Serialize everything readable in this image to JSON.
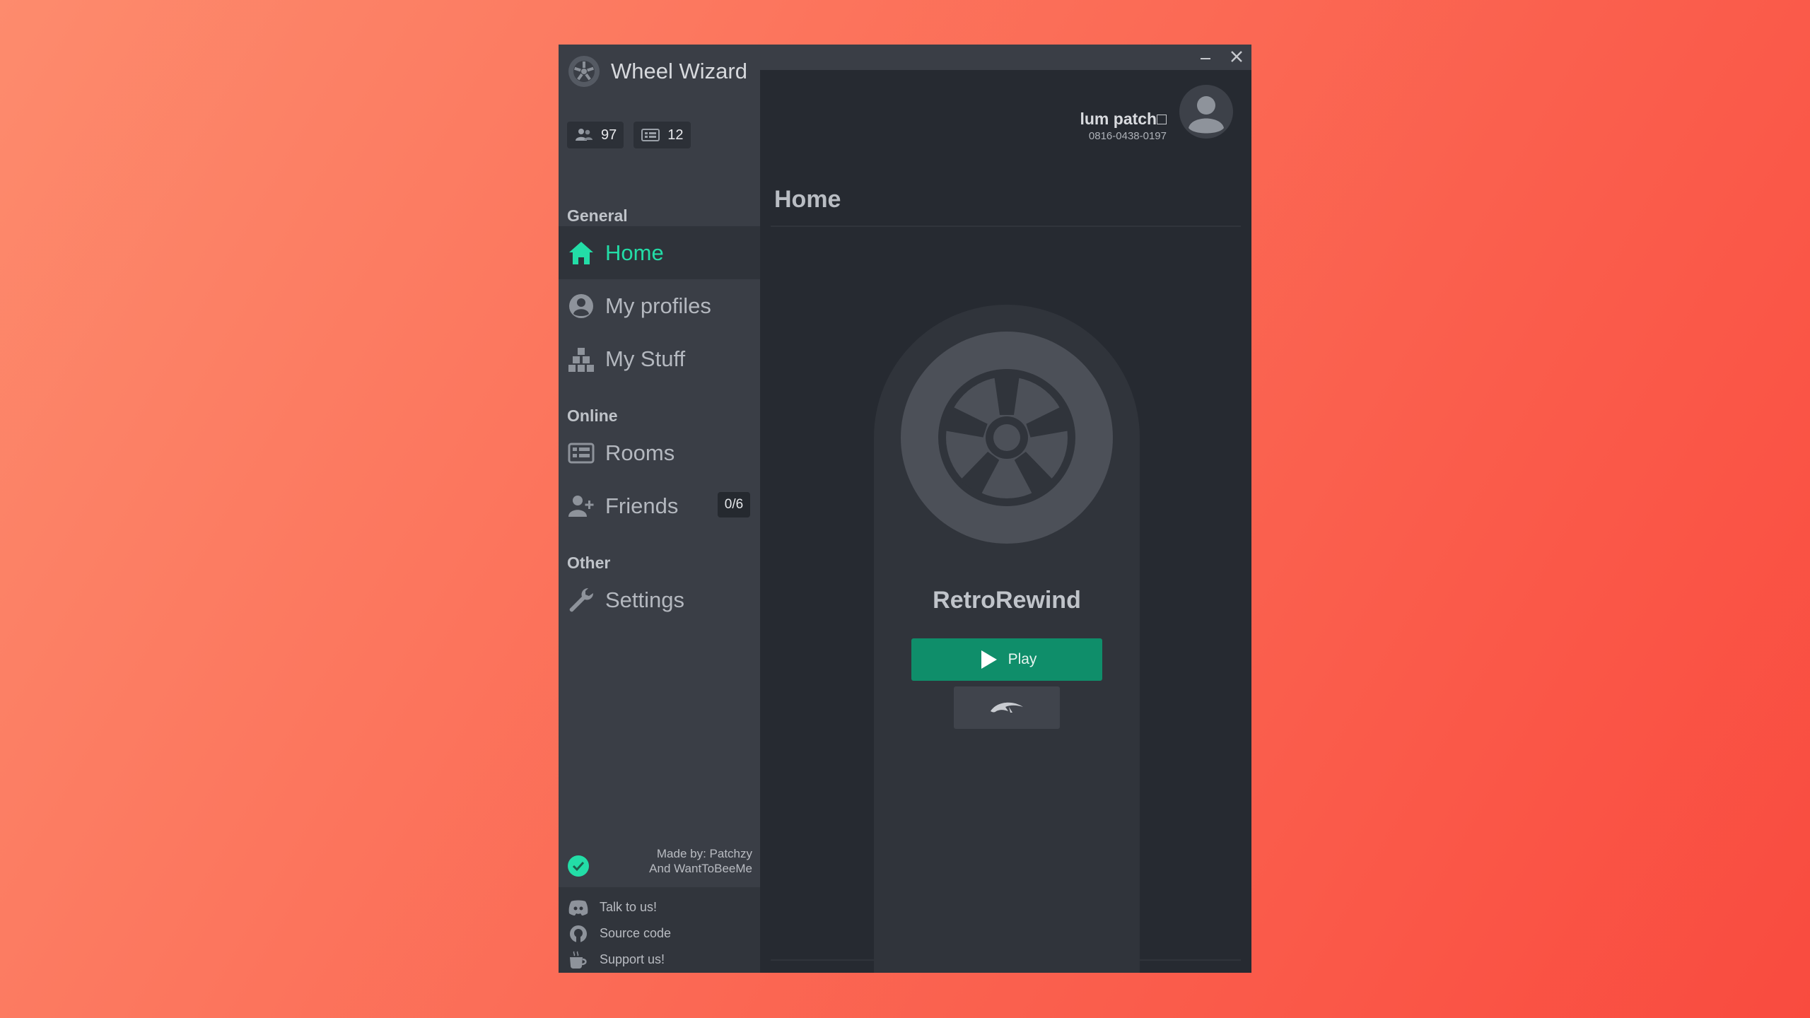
{
  "app": {
    "title": "Wheel Wizard"
  },
  "stats": {
    "players": "97",
    "rooms": "12"
  },
  "sidebar": {
    "sections": {
      "general": "General",
      "online": "Online",
      "other": "Other"
    },
    "items": {
      "home": "Home",
      "profiles": "My profiles",
      "stuff": "My Stuff",
      "rooms": "Rooms",
      "friends": "Friends",
      "settings": "Settings"
    },
    "friends_badge": "0/6",
    "made_by": {
      "line1": "Made by: Patchzy",
      "line2": "And WantToBeeMe"
    },
    "links": {
      "talk": "Talk to us!",
      "source": "Source code",
      "support": "Support us!"
    }
  },
  "user": {
    "name": "lum patch□",
    "friend_code": "0816-0438-0197"
  },
  "main": {
    "page_title": "Home",
    "pack_name": "RetroRewind",
    "play_label": "Play"
  },
  "colors": {
    "accent": "#23dda7",
    "play": "#0f8e6a",
    "sidebar": "#3a3e46",
    "content": "#262a31"
  },
  "icons": {
    "brand": "wheel-logo-icon",
    "players": "users-icon",
    "rooms_stat": "rooms-icon",
    "home": "home-icon",
    "profiles": "user-circle-icon",
    "stuff": "boxes-icon",
    "rooms": "rooms-icon",
    "friends": "add-user-icon",
    "settings": "wrench-icon",
    "status": "check-circle-icon",
    "discord": "discord-icon",
    "github": "github-icon",
    "support": "coffee-icon",
    "minimize": "minimize-icon",
    "close": "close-icon",
    "avatar": "avatar-icon",
    "play": "play-icon",
    "dolphin": "dolphin-icon"
  }
}
